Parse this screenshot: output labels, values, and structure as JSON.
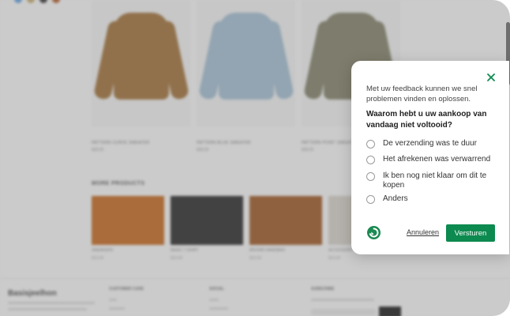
{
  "background": {
    "products": [
      {
        "name": "PATTERN CURVE SWEATER",
        "price": "$38,00",
        "color": "#a77b47"
      },
      {
        "name": "PATTERN BLUE SWEATER",
        "price": "$38,00",
        "color": "#a9c2d4"
      },
      {
        "name": "PATTERN POINT SWEATER",
        "price": "$38,00",
        "color": "#8c8a74"
      }
    ],
    "more_title": "MORE PRODUCTS",
    "thumbs": [
      {
        "name": "SNEAKERS",
        "price": "$10,00",
        "color": "#c8732f"
      },
      {
        "name": "BASIC T-SHIRT",
        "price": "$10,00",
        "color": "#3a3a3a"
      },
      {
        "name": "BROWN HANDBAG",
        "price": "$10,00",
        "color": "#a66435"
      },
      {
        "name": "ACCESSORY",
        "price": "$10,00",
        "color": "#d8d3cc"
      }
    ],
    "footer": {
      "brand": "Basisjeelhon",
      "col1": "CUSTOMER CARE",
      "col2": "SOCIAL",
      "col3": "SUBSCRIBE"
    }
  },
  "dialog": {
    "close_icon": "close-icon",
    "intro": "Met uw feedback kunnen we snel problemen vinden en oplossen.",
    "question": "Waarom hebt u uw aankoop van vandaag niet voltooid?",
    "options": [
      "De verzending was te duur",
      "Het afrekenen was verwarrend",
      "Ik ben nog niet klaar om dit te kopen",
      "Anders"
    ],
    "cancel_label": "Annuleren",
    "submit_label": "Versturen",
    "accent": "#0c8a4f"
  }
}
